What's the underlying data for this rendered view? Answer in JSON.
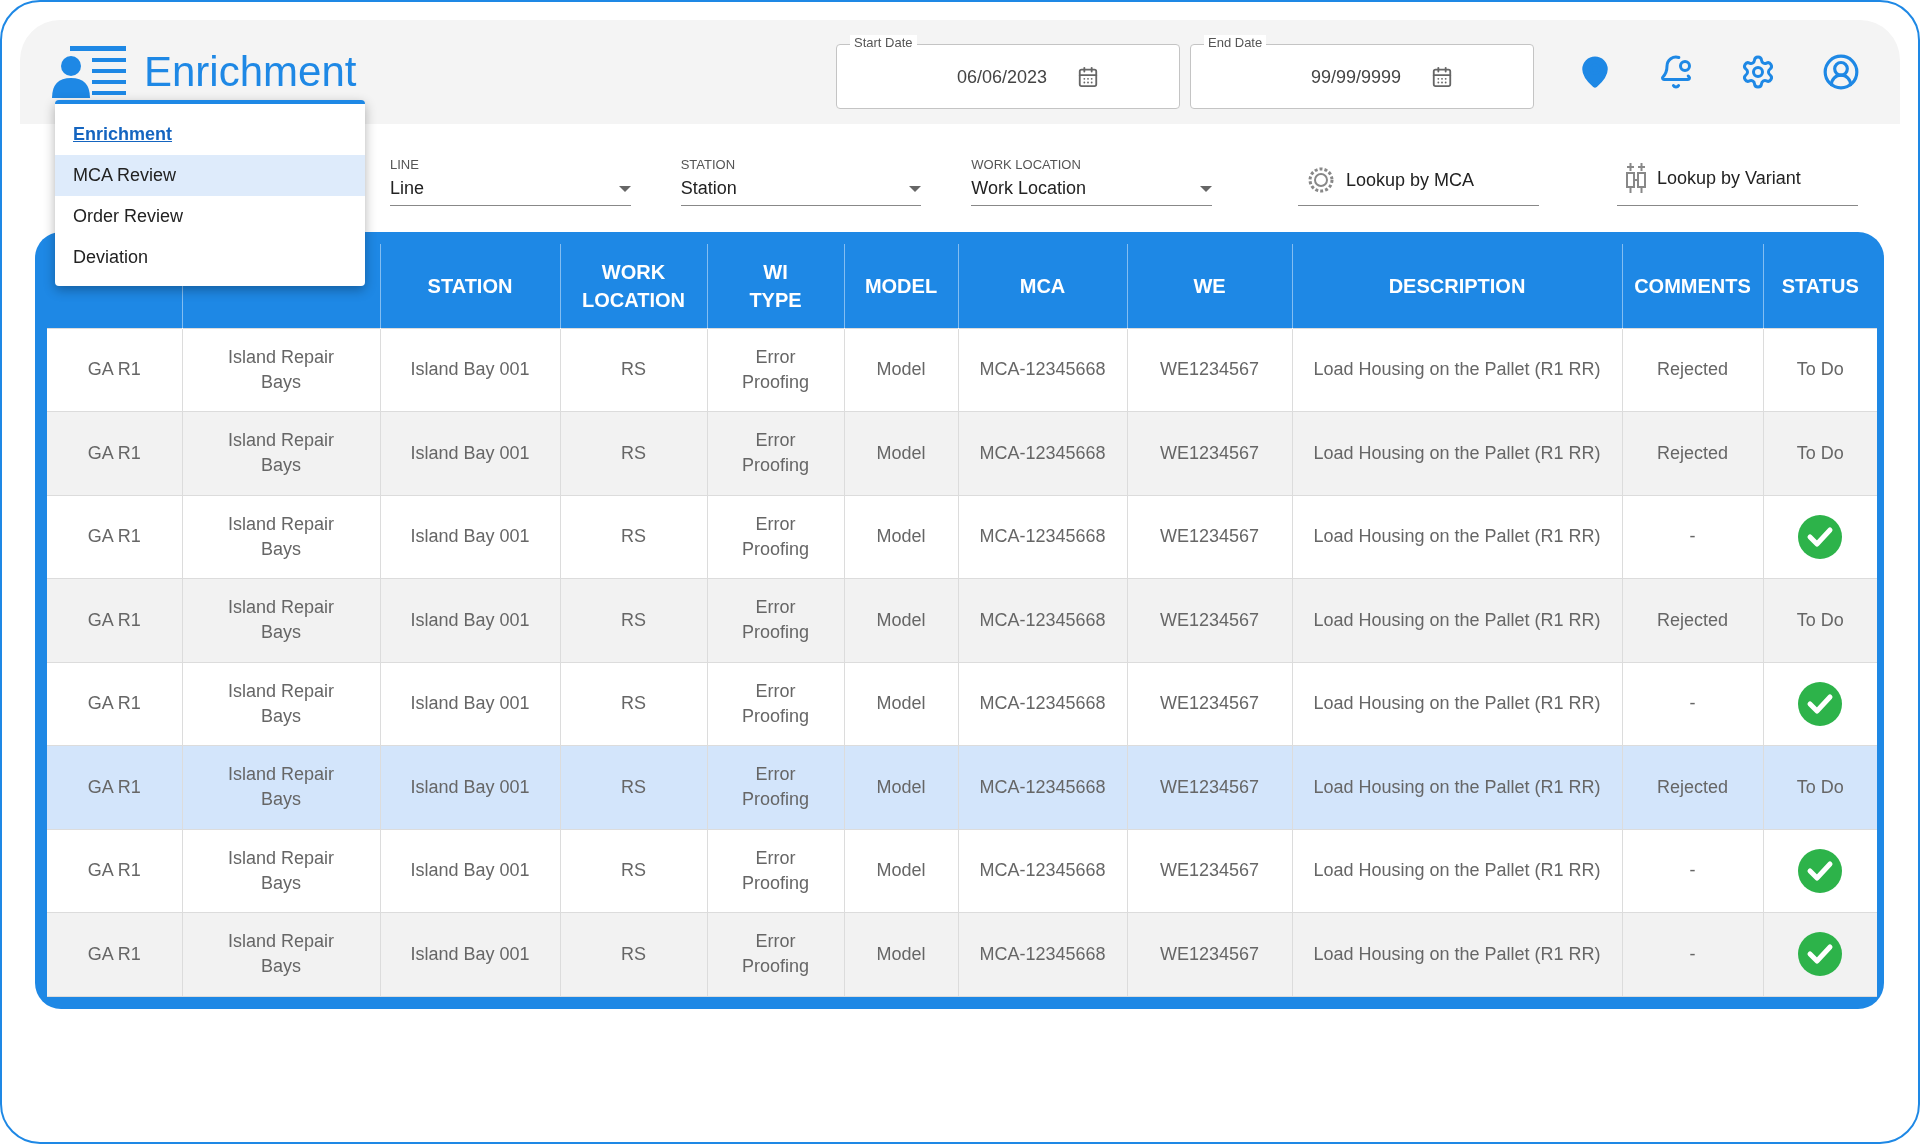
{
  "app": {
    "title": "Enrichment"
  },
  "nav_menu": [
    {
      "label": "Enrichment",
      "current": true,
      "selected": false
    },
    {
      "label": "MCA Review",
      "current": false,
      "selected": true
    },
    {
      "label": "Order Review",
      "current": false,
      "selected": false
    },
    {
      "label": "Deviation",
      "current": false,
      "selected": false
    }
  ],
  "date_range": [
    {
      "label": "Start Date",
      "value": "06/06/2023"
    },
    {
      "label": "End Date",
      "value": "99/99/9999"
    }
  ],
  "filters": [
    {
      "label": "LINE",
      "value": "Line"
    },
    {
      "label": "STATION",
      "value": "Station"
    },
    {
      "label": "WORK LOCATION",
      "value": "Work Location"
    }
  ],
  "lookups": [
    {
      "kind": "gear",
      "label": "Lookup by MCA"
    },
    {
      "kind": "vials",
      "label": "Lookup by Variant"
    }
  ],
  "table": {
    "columns": [
      "",
      "",
      "STATION",
      "WORK LOCATION",
      "WI TYPE",
      "MODEL",
      "MCA",
      "WE",
      "DESCRIPTION",
      "COMMENTS",
      "STATUS"
    ],
    "rows": [
      {
        "selected": false,
        "cells": [
          "GA R1",
          "Island Repair Bays",
          "Island Bay 001",
          "RS",
          "Error Proofing",
          "Model",
          "MCA-12345668",
          "WE1234567",
          "Load Housing on the Pallet (R1 RR)",
          "Rejected"
        ],
        "status": {
          "kind": "text",
          "text": "To Do"
        }
      },
      {
        "selected": false,
        "cells": [
          "GA R1",
          "Island Repair Bays",
          "Island Bay 001",
          "RS",
          "Error Proofing",
          "Model",
          "MCA-12345668",
          "WE1234567",
          "Load Housing on the Pallet (R1 RR)",
          "Rejected"
        ],
        "status": {
          "kind": "text",
          "text": "To Do"
        }
      },
      {
        "selected": false,
        "cells": [
          "GA R1",
          "Island Repair Bays",
          "Island Bay 001",
          "RS",
          "Error Proofing",
          "Model",
          "MCA-12345668",
          "WE1234567",
          "Load Housing on the Pallet (R1 RR)",
          "-"
        ],
        "status": {
          "kind": "check"
        }
      },
      {
        "selected": false,
        "cells": [
          "GA R1",
          "Island Repair Bays",
          "Island Bay 001",
          "RS",
          "Error Proofing",
          "Model",
          "MCA-12345668",
          "WE1234567",
          "Load Housing on the Pallet (R1 RR)",
          "Rejected"
        ],
        "status": {
          "kind": "text",
          "text": "To Do"
        }
      },
      {
        "selected": false,
        "cells": [
          "GA R1",
          "Island Repair Bays",
          "Island Bay 001",
          "RS",
          "Error Proofing",
          "Model",
          "MCA-12345668",
          "WE1234567",
          "Load Housing on the Pallet (R1 RR)",
          "-"
        ],
        "status": {
          "kind": "check"
        }
      },
      {
        "selected": true,
        "cells": [
          "GA R1",
          "Island Repair Bays",
          "Island Bay 001",
          "RS",
          "Error Proofing",
          "Model",
          "MCA-12345668",
          "WE1234567",
          "Load Housing on the Pallet (R1 RR)",
          "Rejected"
        ],
        "status": {
          "kind": "text",
          "text": "To Do"
        }
      },
      {
        "selected": false,
        "cells": [
          "GA R1",
          "Island Repair Bays",
          "Island Bay 001",
          "RS",
          "Error Proofing",
          "Model",
          "MCA-12345668",
          "WE1234567",
          "Load Housing on the Pallet (R1 RR)",
          "-"
        ],
        "status": {
          "kind": "check"
        }
      },
      {
        "selected": false,
        "cells": [
          "GA R1",
          "Island Repair Bays",
          "Island Bay 001",
          "RS",
          "Error Proofing",
          "Model",
          "MCA-12345668",
          "WE1234567",
          "Load Housing on the Pallet (R1 RR)",
          "-"
        ],
        "status": {
          "kind": "check"
        }
      }
    ]
  }
}
